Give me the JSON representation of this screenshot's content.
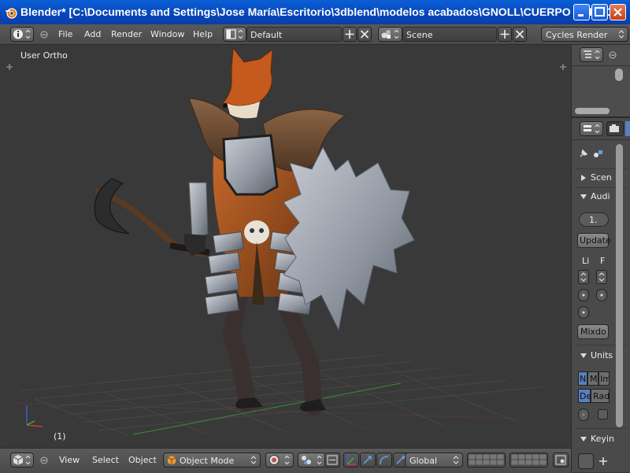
{
  "window": {
    "title": "Blender* [C:\\Documents and Settings\\Jose María\\Escritorio\\3dblend\\modelos acabados\\GNOLL\\CUERPO ZORRO..."
  },
  "top_header": {
    "menus": [
      "File",
      "Add",
      "Render",
      "Window",
      "Help"
    ],
    "layout_name": "Default",
    "scene_name": "Scene",
    "render_engine": "Cycles Render"
  },
  "viewport": {
    "view_label": "User Ortho",
    "frame_label": "(1)"
  },
  "properties_panel": {
    "sections": {
      "scene": "Scen",
      "audio": "Audi",
      "units": "Units",
      "keying": "Keyin"
    },
    "audio_value": "1.",
    "update_button": "Update",
    "col_labels": [
      "Li",
      "F"
    ],
    "mixdown_button": "Mixdo",
    "units_buttons": [
      "N",
      "M",
      "Im"
    ],
    "rotation_buttons": [
      "De",
      "Rad"
    ]
  },
  "bottom_header": {
    "menus": [
      "View",
      "Select",
      "Object"
    ],
    "mode": "Object Mode",
    "orientation": "Global"
  },
  "colors": {
    "title_bar": "#0845b8",
    "accent_blue": "#5680c2",
    "viewport_bg": "#393939"
  }
}
